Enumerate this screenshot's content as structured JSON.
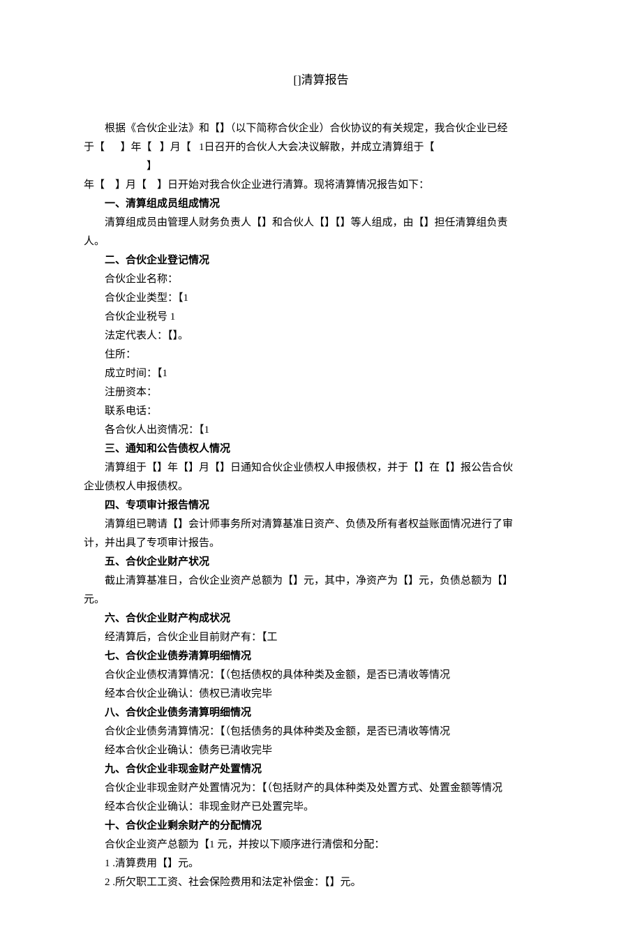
{
  "title": "[]清算报告",
  "p1": "根据《合伙企业法》和【】（以下简称合伙企业）合伙协议的有关规定，我合伙企业已经",
  "p2_prefix": "于【",
  "p2_year": "】年【",
  "p2_month": "】月【",
  "p2_day": "1日召开的合伙人大会决议解散，并成立清算组于【",
  "p3": "】",
  "p4": "年【　】月【　】日开始对我合伙企业进行清算。现将清算情况报告如下：",
  "h1": "一、清算组成员组成情况",
  "p5": "清算组成员由管理人财务负责人【】和合伙人【】【】等人组成，由【】担任清算组负责",
  "p6": "人。",
  "h2": "二、合伙企业登记情况",
  "reg_name": "合伙企业名称：",
  "reg_type": "合伙企业类型：【1",
  "reg_tax": "合伙企业税号 1",
  "reg_legal": "法定代表人：【】。",
  "reg_addr": "住所：",
  "reg_est": "成立时间：【1",
  "reg_capital": "注册资本：",
  "reg_phone": "联系电话：",
  "reg_partners": "各合伙人出资情况：【1",
  "h3": "三、通知和公告债权人情况",
  "p7": "清算组于【】年【】月【】日通知合伙企业债权人申报债权，并于【】在【】报公告合伙",
  "p8": "企业债权人申报债权。",
  "h4": "四、专项审计报告情况",
  "p9": "清算组已聘请【】会计师事务所对清算基准日资产、负债及所有者权益账面情况进行了审",
  "p10": "计，并出具了专项审计报告。",
  "h5": "五、合伙企业财产状况",
  "p11": "截止清算基准日，合伙企业资产总额为【】元，其中，净资产为【】元，负债总额为【】",
  "p12": "元。",
  "h6": "六、合伙企业财产构成状况",
  "p13": "经清算后，合伙企业目前财产有：【工",
  "h7": "七、合伙企业债券清算明细情况",
  "p14": "合伙企业债权清算情况：【（包括债权的具体种类及金额，是否已清收等情况",
  "p15": "经本合伙企业确认：债权已清收完毕",
  "h8": "八、合伙企业债务清算明细情况",
  "p16": "合伙企业债务清算情况：【（包括债务的具体种类及金额，是否已清收等情况",
  "p17": "经本合伙企业确认：债务已清收完毕",
  "h9": "九、合伙企业非现金财产处置情况",
  "p18": "合伙企业非现金财产处置情况为：【（包括财产的具体种类及处置方式、处置金额等情况",
  "p19": "经本合伙企业确认：非现金财产已处置完毕。",
  "h10": "十、合伙企业剩余财产的分配情况",
  "p20": "合伙企业资产总额为【1 元，并按以下顺序进行清偿和分配：",
  "item1": "1 .清算费用【】元。",
  "item2": "2 .所欠职工工资、社会保险费用和法定补偿金：【】元。"
}
